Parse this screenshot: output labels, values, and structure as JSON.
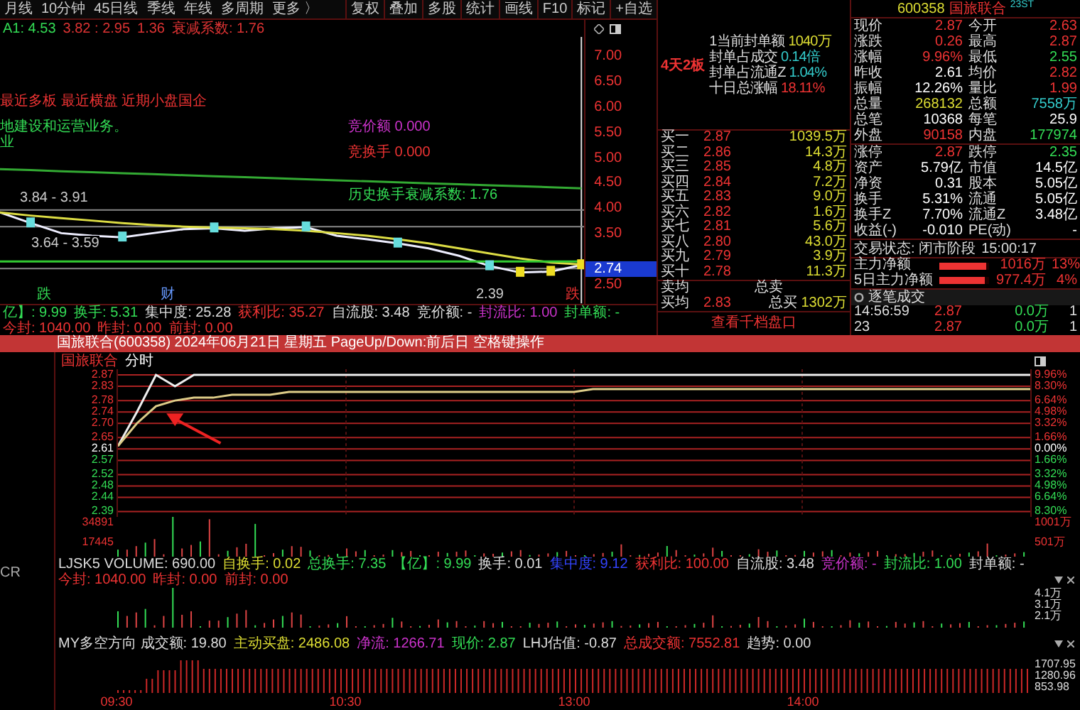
{
  "toolbar": {
    "periods": [
      "月线",
      "10分钟",
      "45日线",
      "季线",
      "年线",
      "多周期",
      "更多 〉"
    ],
    "tools": [
      "复权",
      "叠加",
      "多股",
      "统计",
      "画线",
      "F10",
      "标记",
      "+自选"
    ]
  },
  "kline": {
    "indicator_line": [
      {
        "text": "A1: 4.53",
        "color": "#33dd55"
      },
      {
        "text": "3.82 : 2.95",
        "color": "#dd3333"
      },
      {
        "text": "1.36",
        "color": "#dd3333"
      },
      {
        "text": "衰减系数: 1.76",
        "color": "#dd3333"
      }
    ],
    "notes": [
      {
        "text": "最近多板 最近横盘 近期小盘国企",
        "color": "#ee3333"
      },
      {
        "text": "地建设和运营业务。",
        "color": "#33dd55"
      },
      {
        "text": "业",
        "color": "#33dd55"
      },
      {
        "text": "竞价额 0.000",
        "color": "#cc33cc"
      },
      {
        "text": "竞换手 0.000",
        "color": "#ee3333"
      },
      {
        "text": "历史换手衰减系数: 1.76",
        "color": "#33dd55"
      }
    ],
    "labels": [
      {
        "text": "3.84 - 3.91",
        "color": "#cccccc"
      },
      {
        "text": "3.64 - 3.59",
        "color": "#cccccc"
      },
      {
        "text": "跌",
        "color": "#33dd55"
      },
      {
        "text": "财",
        "color": "#6699ff"
      },
      {
        "text": "2.39",
        "color": "#cccccc"
      },
      {
        "text": "跌",
        "color": "#ee3333"
      }
    ],
    "chart_data": {
      "type": "line",
      "yticks": [
        {
          "value": 7,
          "label": "7.00"
        },
        {
          "value": 6.5,
          "label": "6.50"
        },
        {
          "value": 6,
          "label": "6.00"
        },
        {
          "value": 5.5,
          "label": "5.50"
        },
        {
          "value": 5,
          "label": "5.00"
        },
        {
          "value": 4.5,
          "label": "4.50"
        },
        {
          "value": 4,
          "label": "4.00"
        },
        {
          "value": 3.5,
          "label": "3.50"
        },
        {
          "value": 2.5,
          "label": "2.50"
        }
      ],
      "ylim": [
        2.11,
        7.73
      ],
      "series": [
        {
          "color": "#eeeeff",
          "values": [
            3.91,
            3.7,
            3.5,
            3.45,
            3.42,
            3.5,
            3.58,
            3.6,
            3.55,
            3.6,
            3.62,
            3.45,
            3.38,
            3.3,
            3.2,
            3.05,
            2.85,
            2.72,
            2.74,
            2.87
          ]
        },
        {
          "color": "#dddd44",
          "values": [
            3.91,
            3.85,
            3.8,
            3.75,
            3.7,
            3.66,
            3.63,
            3.61,
            3.6,
            3.58,
            3.55,
            3.5,
            3.45,
            3.38,
            3.3,
            3.2,
            3.1,
            3.0,
            2.92,
            2.88
          ]
        },
        {
          "color": "#33aa33",
          "values": [
            4.77,
            4.75,
            4.73,
            4.71,
            4.69,
            4.67,
            4.65,
            4.63,
            4.61,
            4.59,
            4.57,
            4.55,
            4.53,
            4.51,
            4.49,
            4.47,
            4.45,
            4.43,
            4.41,
            4.39
          ]
        },
        {
          "color": "#33cc33",
          "values": [
            2.94,
            2.94,
            2.94,
            2.94,
            2.94,
            2.94,
            2.94,
            2.94,
            2.94,
            2.94,
            2.94,
            2.94,
            2.94,
            2.94,
            2.94,
            2.94,
            2.94,
            2.94,
            2.94,
            2.94
          ]
        }
      ]
    },
    "current_price": "2.74",
    "stats": [
      {
        "text": "亿】: 9.99",
        "color": "#33dd55"
      },
      {
        "text": "换手: 5.31",
        "color": "#33dd55"
      },
      {
        "text": "集中度: 25.28",
        "color": "#dddddd"
      },
      {
        "text": "获利比: 35.27",
        "color": "#ee3333"
      },
      {
        "text": "自流股: 3.48",
        "color": "#dddddd"
      },
      {
        "text": "竞价额: -",
        "color": "#dddddd"
      },
      {
        "text": "封流比: 1.00",
        "color": "#cc33cc"
      },
      {
        "text": "封单额: -",
        "color": "#33dd55"
      },
      {
        "text": "今封: 1040.00",
        "color": "#ee3333"
      },
      {
        "text": "昨封: 0.00",
        "color": "#ee3333"
      },
      {
        "text": "前封: 0.00",
        "color": "#ee3333"
      }
    ]
  },
  "limit_info": {
    "badge": "4天2板",
    "lines": [
      {
        "label": "1当前封单额",
        "value": "1040万",
        "color": "#dddd33"
      },
      {
        "label": "封单占成交",
        "value": "0.14倍",
        "color": "#33cccc"
      },
      {
        "label": "封单占流通Z",
        "value": "1.04%",
        "color": "#33cccc"
      },
      {
        "label": "十日总涨幅",
        "value": "18.11%",
        "color": "#ee3333"
      }
    ]
  },
  "order_book": {
    "rows": [
      {
        "label": "买一",
        "price": "2.87",
        "volume": "1039.5万"
      },
      {
        "label": "买二",
        "price": "2.86",
        "volume": "14.3万"
      },
      {
        "label": "买三",
        "price": "2.85",
        "volume": "4.8万"
      },
      {
        "label": "买四",
        "price": "2.84",
        "volume": "7.2万"
      },
      {
        "label": "买五",
        "price": "2.83",
        "volume": "9.0万"
      },
      {
        "label": "买六",
        "price": "2.82",
        "volume": "1.6万"
      },
      {
        "label": "买七",
        "price": "2.81",
        "volume": "5.6万"
      },
      {
        "label": "买八",
        "price": "2.80",
        "volume": "43.0万"
      },
      {
        "label": "买九",
        "price": "2.79",
        "volume": "3.9万"
      },
      {
        "label": "买十",
        "price": "2.78",
        "volume": "11.3万"
      }
    ],
    "sell_avg": {
      "label": "卖均",
      "total_label": "总卖"
    },
    "buy_avg": {
      "label": "买均",
      "price": "2.83",
      "total_label": "总买",
      "total": "1302万"
    },
    "depth_link": "查看千档盘口"
  },
  "quote": {
    "code": "600358",
    "name": "国旅联合",
    "tag": "23ST",
    "rows": [
      {
        "left": {
          "label": "现价",
          "value": "2.87",
          "color": "#ee3333"
        },
        "right": {
          "label": "今开",
          "value": "2.63",
          "color": "#ee3333"
        }
      },
      {
        "left": {
          "label": "涨跌",
          "value": "0.26",
          "color": "#ee3333"
        },
        "right": {
          "label": "最高",
          "value": "2.87",
          "color": "#ee3333"
        }
      },
      {
        "left": {
          "label": "涨幅",
          "value": "9.96%",
          "color": "#ee3333"
        },
        "right": {
          "label": "最低",
          "value": "2.55",
          "color": "#33dd55"
        }
      },
      {
        "left": {
          "label": "昨收",
          "value": "2.61",
          "color": "#ffffff"
        },
        "right": {
          "label": "均价",
          "value": "2.82",
          "color": "#ee3333"
        }
      },
      {
        "left": {
          "label": "振幅",
          "value": "12.26%",
          "color": "#ffffff"
        },
        "right": {
          "label": "量比",
          "value": "1.99",
          "color": "#ee3333"
        }
      },
      {
        "left": {
          "label": "总量",
          "value": "268132",
          "color": "#dddd33"
        },
        "right": {
          "label": "总额",
          "value": "7558万",
          "color": "#33cccc"
        }
      },
      {
        "left": {
          "label": "总笔",
          "value": "10368",
          "color": "#ffffff"
        },
        "right": {
          "label": "每笔",
          "value": "25.9",
          "color": "#ffffff"
        }
      },
      {
        "left": {
          "label": "外盘",
          "value": "90158",
          "color": "#ee3333"
        },
        "right": {
          "label": "内盘",
          "value": "177974",
          "color": "#33dd55"
        }
      }
    ],
    "fundamentals": [
      {
        "left": {
          "label": "涨停",
          "value": "2.87",
          "color": "#ee3333"
        },
        "right": {
          "label": "跌停",
          "value": "2.35",
          "color": "#33dd55"
        }
      },
      {
        "left": {
          "label": "资产",
          "value": "5.79亿",
          "color": "#ffffff"
        },
        "right": {
          "label": "市值",
          "value": "14.5亿",
          "color": "#ffffff"
        }
      },
      {
        "left": {
          "label": "净资",
          "value": "0.31",
          "color": "#ffffff"
        },
        "right": {
          "label": "股本",
          "value": "5.05亿",
          "color": "#ffffff"
        }
      },
      {
        "left": {
          "label": "换手",
          "value": "5.31%",
          "color": "#ffffff"
        },
        "right": {
          "label": "流通",
          "value": "5.05亿",
          "color": "#ffffff"
        }
      },
      {
        "left": {
          "label": "换手Z",
          "value": "7.70%",
          "color": "#ffffff"
        },
        "right": {
          "label": "流通Z",
          "value": "3.48亿",
          "color": "#ffffff"
        }
      },
      {
        "left": {
          "label": "收益(-)",
          "value": "-0.010",
          "color": "#ffffff"
        },
        "right": {
          "label": "PE(动)",
          "value": "-",
          "color": "#ffffff"
        }
      }
    ],
    "status_label": "交易状态: 闭市阶段",
    "status_time": "15:00:17",
    "flows": [
      {
        "label": "主力净额",
        "level": 0.95,
        "value": "1016万",
        "pct": "13%"
      },
      {
        "label": "5日主力净额",
        "level": 0.9,
        "value": "977.4万",
        "pct": "4%"
      }
    ],
    "ticks_title": "逐笔成交",
    "ticks": [
      {
        "time": "14:56:59",
        "price": "2.87",
        "volume": "0.0万",
        "count": "1"
      },
      {
        "time": "23",
        "price": "2.87",
        "volume": "0.0万",
        "count": "1"
      }
    ]
  },
  "intraday": {
    "title": "国旅联合(600358) 2024年06月21日 星期五 PageUp/Down:前后日 空格键操作",
    "side_label": "CR",
    "name": "国旅联合",
    "mode": "分时",
    "chart_data": {
      "type": "line",
      "ylim": [
        2.37,
        2.89
      ],
      "grid": true,
      "categories": [
        null,
        null,
        null,
        null,
        null,
        null,
        null,
        null,
        null,
        null,
        null,
        null,
        null,
        null,
        null,
        null,
        null,
        null,
        null,
        null,
        null,
        null,
        null,
        null,
        null,
        null,
        null,
        null,
        null,
        null,
        null,
        null,
        null,
        null,
        null,
        null,
        null,
        null,
        null,
        null,
        null,
        null,
        null,
        null,
        null,
        null,
        null,
        null,
        null
      ],
      "yticks": [
        {
          "value": 2.87,
          "label": "2.87"
        },
        {
          "value": 2.83,
          "label": "2.83"
        },
        {
          "value": 2.78,
          "label": "2.78"
        },
        {
          "value": 2.74,
          "label": "2.74"
        },
        {
          "value": 2.7,
          "label": "2.70"
        },
        {
          "value": 2.65,
          "label": "2.65"
        },
        {
          "value": 2.61,
          "label": "2.61"
        },
        {
          "value": 2.57,
          "label": "2.57"
        },
        {
          "value": 2.52,
          "label": "2.52"
        },
        {
          "value": 2.48,
          "label": "2.48"
        },
        {
          "value": 2.44,
          "label": "2.44"
        },
        {
          "value": 2.39,
          "label": "2.39"
        }
      ],
      "series": [
        {
          "color": "#eeeeee",
          "values": [
            2.62,
            2.74,
            2.87,
            2.83,
            2.87,
            2.87,
            2.87,
            2.87,
            2.87,
            2.87,
            2.87,
            2.87,
            2.87,
            2.87,
            2.87,
            2.87,
            2.87,
            2.87,
            2.87,
            2.87,
            2.87,
            2.87,
            2.87,
            2.87,
            2.87,
            2.87,
            2.87,
            2.87,
            2.87,
            2.87,
            2.87,
            2.87,
            2.87,
            2.87,
            2.87,
            2.87,
            2.87,
            2.87,
            2.87,
            2.87,
            2.87,
            2.87,
            2.87,
            2.87,
            2.87,
            2.87,
            2.87,
            2.87,
            2.87
          ]
        },
        {
          "color": "#ddcc88",
          "values": [
            2.62,
            2.7,
            2.76,
            2.78,
            2.79,
            2.79,
            2.8,
            2.8,
            2.8,
            2.81,
            2.81,
            2.81,
            2.81,
            2.81,
            2.81,
            2.81,
            2.81,
            2.81,
            2.81,
            2.81,
            2.81,
            2.81,
            2.81,
            2.81,
            2.81,
            2.82,
            2.82,
            2.82,
            2.82,
            2.82,
            2.82,
            2.82,
            2.82,
            2.82,
            2.82,
            2.82,
            2.82,
            2.82,
            2.82,
            2.82,
            2.82,
            2.82,
            2.82,
            2.82,
            2.82,
            2.82,
            2.82,
            2.82,
            2.82
          ]
        }
      ]
    },
    "price_axis": [
      {
        "color": "#ee3333"
      },
      {
        "color": "#ee3333"
      },
      {
        "color": "#ee3333"
      },
      {
        "color": "#ee3333"
      },
      {
        "color": "#ee3333"
      },
      {
        "color": "#ee3333"
      },
      {
        "color": "#ffffff"
      },
      {
        "color": "#33dd55"
      },
      {
        "color": "#33dd55"
      },
      {
        "color": "#33dd55"
      },
      {
        "color": "#33dd55"
      },
      {
        "color": "#33dd55"
      }
    ],
    "pct_axis": [
      {
        "label": "9.96%",
        "color": "#ee3333"
      },
      {
        "label": "8.30%",
        "color": "#ee3333"
      },
      {
        "label": "6.64%",
        "color": "#ee3333"
      },
      {
        "label": "4.98%",
        "color": "#ee3333"
      },
      {
        "label": "3.32%",
        "color": "#ee3333"
      },
      {
        "label": "1.66%",
        "color": "#ee3333"
      },
      {
        "label": "0.00%",
        "color": "#ffffff"
      },
      {
        "label": "1.66%",
        "color": "#33dd55"
      },
      {
        "label": "3.32%",
        "color": "#33dd55"
      },
      {
        "label": "4.98%",
        "color": "#33dd55"
      },
      {
        "label": "6.64%",
        "color": "#33dd55"
      },
      {
        "label": "8.30%",
        "color": "#33dd55"
      }
    ],
    "volume_axis": [
      "34891",
      "17445"
    ],
    "volume_right_axis": [
      "1001万",
      "501万"
    ],
    "indicator1": [
      {
        "text": "LJSK5 VOLUME: 690.00",
        "color": "#dddddd"
      },
      {
        "text": "自换手: 0.02",
        "color": "#dddd33"
      },
      {
        "text": "总换手: 7.35",
        "color": "#33dd55"
      },
      {
        "text": "【亿】: 9.99",
        "color": "#33dd55"
      },
      {
        "text": "换手: 0.01",
        "color": "#dddddd"
      },
      {
        "text": "集中度: 9.12",
        "color": "#3344ff"
      },
      {
        "text": "获利比: 100.00",
        "color": "#ee3333"
      },
      {
        "text": "自流股: 3.48",
        "color": "#dddddd"
      },
      {
        "text": "竞价额: -",
        "color": "#cc33cc"
      },
      {
        "text": "封流比: 1.00",
        "color": "#33dd55"
      },
      {
        "text": "封单额: -",
        "color": "#dddddd"
      },
      {
        "text": "今封: 1040.00",
        "color": "#ee3333"
      },
      {
        "text": "昨封: 0.00",
        "color": "#ee3333"
      },
      {
        "text": "前封: 0.00",
        "color": "#ee3333"
      }
    ],
    "indicator1_axis": [
      "4.1万",
      "3.1万",
      "2.1万"
    ],
    "indicator2": [
      {
        "text": "MY多空方向 成交额: 19.80",
        "color": "#dddddd"
      },
      {
        "text": "主动买盘: 2486.08",
        "color": "#dddd33"
      },
      {
        "text": "净流: 1266.71",
        "color": "#cc33cc"
      },
      {
        "text": "现价: 2.87",
        "color": "#33dd55"
      },
      {
        "text": "LHJ估值: -0.87",
        "color": "#dddddd"
      },
      {
        "text": "总成交额: 7552.81",
        "color": "#ee3333"
      },
      {
        "text": "趋势: 0.00",
        "color": "#dddddd"
      }
    ],
    "indicator2_axis": [
      "1707.95",
      "1280.96",
      "853.98"
    ],
    "time_axis": [
      "09:30",
      "10:30",
      "13:00",
      "14:00"
    ]
  }
}
